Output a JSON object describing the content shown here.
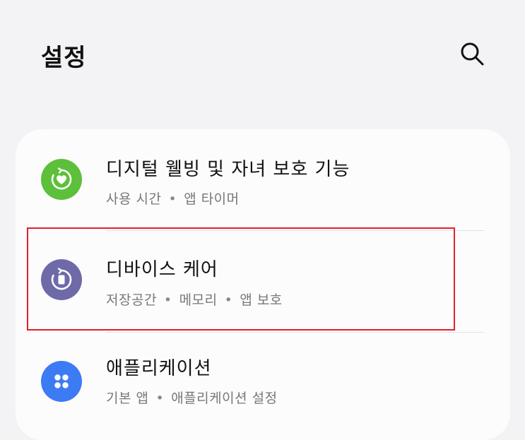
{
  "header": {
    "title": "설정",
    "search_icon": "search-icon"
  },
  "items": [
    {
      "title": "디지털 웰빙 및 자녀 보호 기능",
      "subtitle_parts": [
        "사용 시간",
        "앱 타이머"
      ],
      "icon": "heart-refresh-icon",
      "icon_color": "#5cc03a"
    },
    {
      "title": "디바이스 케어",
      "subtitle_parts": [
        "저장공간",
        "메모리",
        "앱 보호"
      ],
      "icon": "device-care-icon",
      "icon_color": "#6e6aa8"
    },
    {
      "title": "애플리케이션",
      "subtitle_parts": [
        "기본 앱",
        "애플리케이션 설정"
      ],
      "icon": "apps-grid-icon",
      "icon_color": "#3d7bf5"
    }
  ],
  "colors": {
    "background": "#f3f3f5",
    "card": "#fcfcfd",
    "highlight": "#e0202a"
  },
  "separator": "•"
}
